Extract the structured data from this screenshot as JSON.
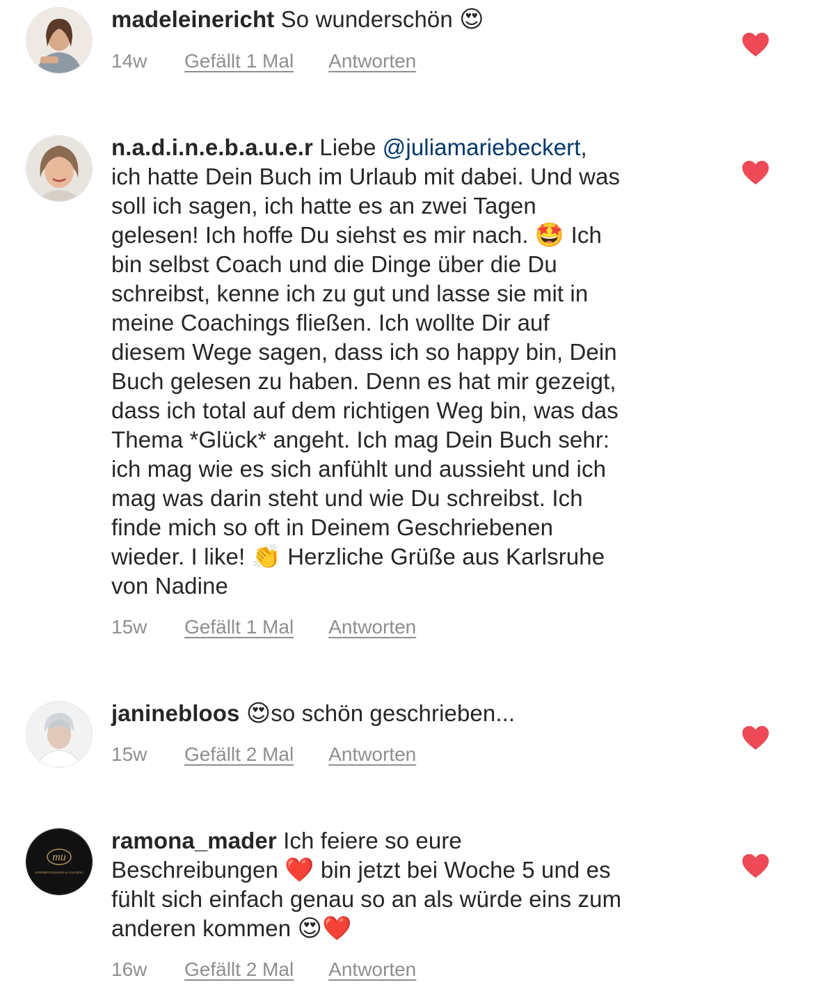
{
  "like_color": "#ed4956",
  "comments": [
    {
      "username": "madeleinericht",
      "text_before": "So wunderschön ",
      "emoji_end": "😍",
      "time": "14w",
      "likes_label": "Gefällt 1 Mal",
      "reply_label": "Antworten",
      "avatar_icon": "avatar-woman-photo"
    },
    {
      "username": "n.a.d.i.n.e.b.a.u.e.r",
      "text_pre": "Liebe ",
      "mention": "@juliamariebeckert",
      "text_part1": ",\nich hatte Dein Buch im Urlaub mit dabei. Und was\nsoll ich sagen, ich hatte es an zwei Tagen\ngelesen! Ich hoffe Du siehst es mir nach. ",
      "emoji1": "🤩",
      "text_part2": " Ich\nbin selbst Coach und die Dinge über die Du\nschreibst, kenne ich zu gut und lasse sie mit in\nmeine Coachings fließen. Ich wollte Dir auf\ndiesem Wege sagen, dass ich so happy bin, Dein\nBuch gelesen zu haben. Denn es hat mir gezeigt,\ndass ich total auf dem richtigen Weg bin, was das\nThema *Glück* angeht. Ich mag Dein Buch sehr:\nich mag wie es sich anfühlt und aussieht und ich\nmag was darin steht und wie Du schreibst. Ich\nfinde mich so oft in Deinem Geschriebenen\nwieder. I like! ",
      "emoji2": "👏",
      "text_part3": " Herzliche Grüße aus Karlsruhe\nvon Nadine",
      "time": "15w",
      "likes_label": "Gefällt 1 Mal",
      "reply_label": "Antworten",
      "avatar_icon": "avatar-woman-photo"
    },
    {
      "username": "janinebloos",
      "emoji_start": "😍",
      "text_after": "so schön geschrieben...",
      "time": "15w",
      "likes_label": "Gefällt 2 Mal",
      "reply_label": "Antworten",
      "avatar_icon": "avatar-woman-photo"
    },
    {
      "username": "ramona_mader",
      "text_part1": "Ich feiere so eure\nBeschreibungen ",
      "emoji1": "❤️",
      "text_part2": " bin jetzt bei Woche 5 und es\nfühlt sich einfach genau so an als würde eins zum\nanderen kommen ",
      "emoji2": "😍",
      "emoji3": "❤️",
      "time": "16w",
      "likes_label": "Gefällt 2 Mal",
      "reply_label": "Antworten",
      "avatar_logo_text": "KINDERFOTOGRAFIE & COACHING",
      "avatar_icon": "avatar-logo-mu"
    }
  ]
}
